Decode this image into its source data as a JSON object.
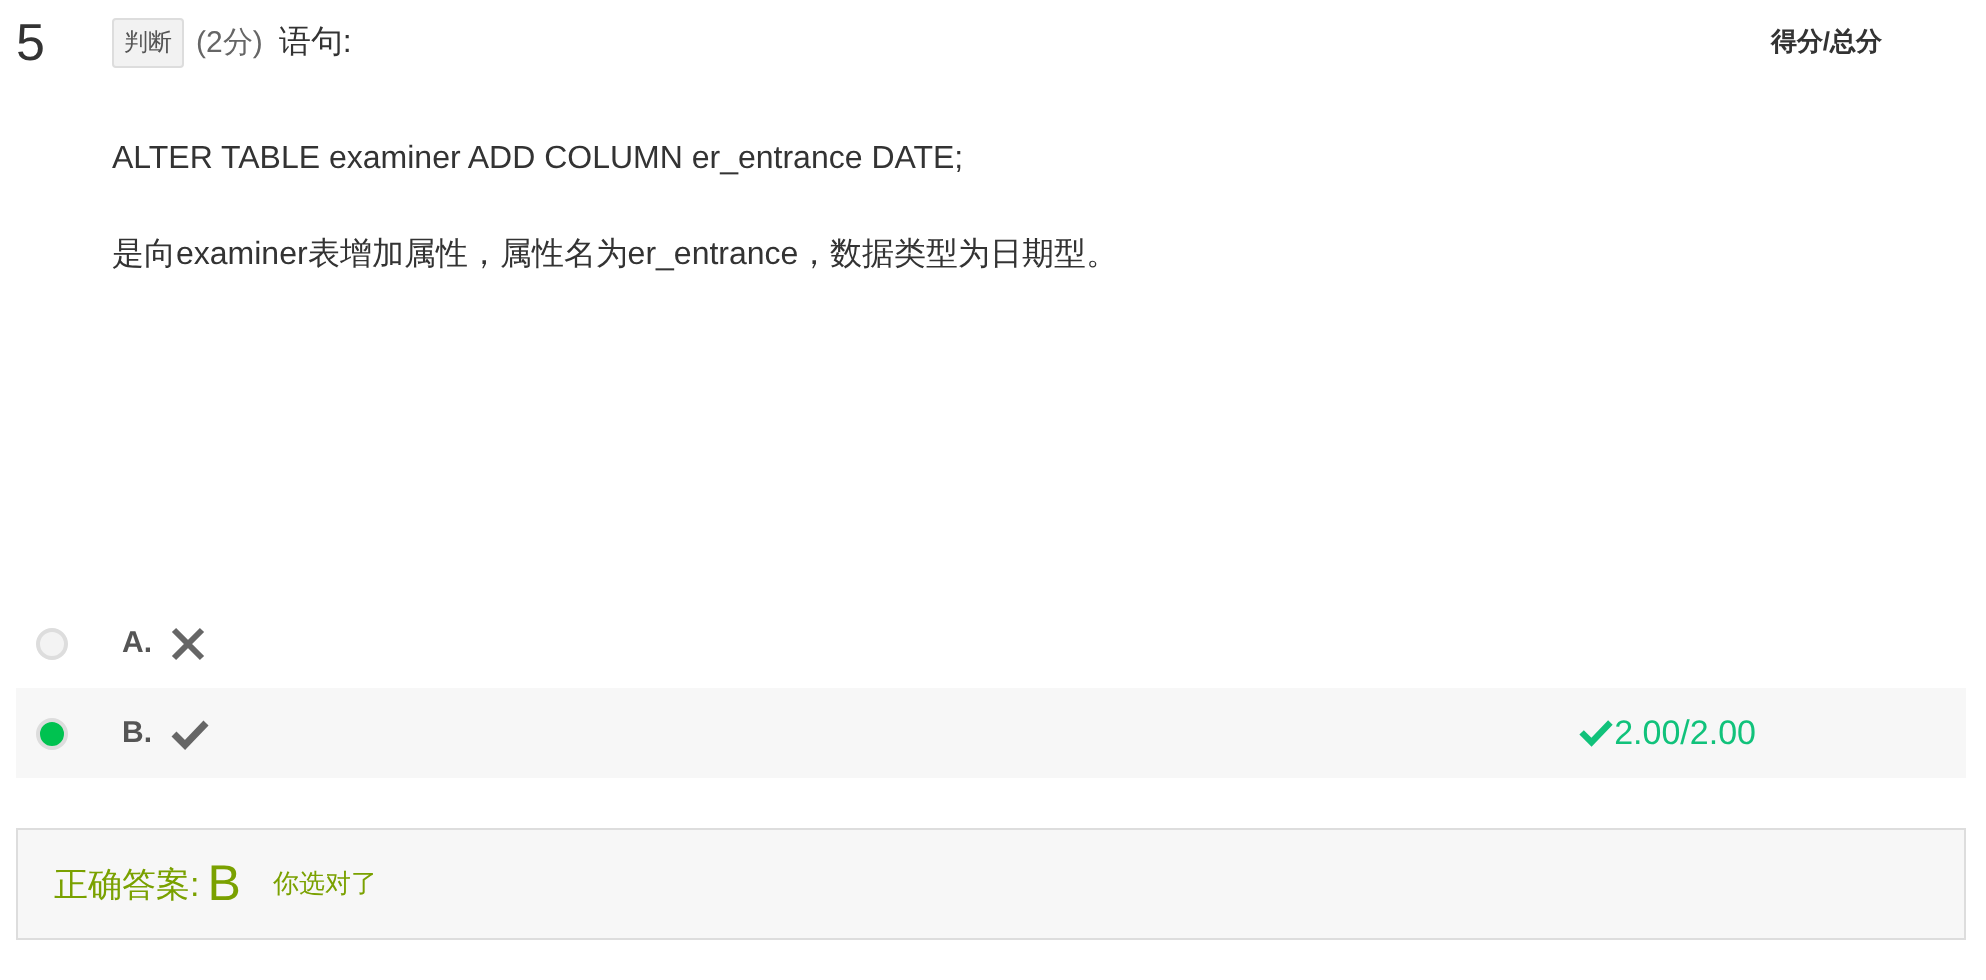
{
  "question": {
    "number": "5",
    "type_tag": "判断",
    "points": "(2分)",
    "prompt": "语句:",
    "score_header": "得分/总分",
    "paragraphs": [
      "ALTER TABLE examiner ADD COLUMN er_entrance DATE;",
      "是向examiner表增加属性，属性名为er_entrance，数据类型为日期型。"
    ]
  },
  "options": [
    {
      "letter": "A.",
      "kind": "cross",
      "selected": false
    },
    {
      "letter": "B.",
      "kind": "check",
      "selected": true,
      "score": "2.00/2.00"
    }
  ],
  "answer": {
    "label": "正确答案:",
    "value": "B",
    "verdict": "你选对了"
  }
}
